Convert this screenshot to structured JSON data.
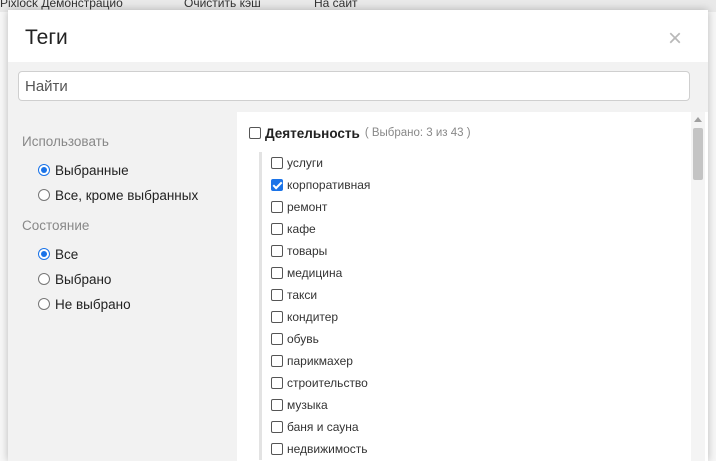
{
  "background": {
    "strip_texts": [
      "Pixlock Демонстрацио",
      "Очистить кэш",
      "На сайт"
    ]
  },
  "modal": {
    "title": "Теги",
    "close_icon": "×"
  },
  "search": {
    "placeholder": "Найти"
  },
  "filters": {
    "use_title": "Использовать",
    "use_options": [
      {
        "label": "Выбранные",
        "selected": true
      },
      {
        "label": "Все, кроме выбранных",
        "selected": false
      }
    ],
    "state_title": "Состояние",
    "state_options": [
      {
        "label": "Все",
        "selected": true
      },
      {
        "label": "Выбрано",
        "selected": false
      },
      {
        "label": "Не выбрано",
        "selected": false
      }
    ]
  },
  "group": {
    "name": "Деятельность",
    "count": "( Выбрано: 3 из 43 )",
    "checked": false,
    "tags": [
      {
        "label": "услуги",
        "checked": false
      },
      {
        "label": "корпоративная",
        "checked": true
      },
      {
        "label": "ремонт",
        "checked": false
      },
      {
        "label": "кафе",
        "checked": false
      },
      {
        "label": "товары",
        "checked": false
      },
      {
        "label": "медицина",
        "checked": false
      },
      {
        "label": "такси",
        "checked": false
      },
      {
        "label": "кондитер",
        "checked": false
      },
      {
        "label": "обувь",
        "checked": false
      },
      {
        "label": "парикмахер",
        "checked": false
      },
      {
        "label": "строительство",
        "checked": false
      },
      {
        "label": "музыка",
        "checked": false
      },
      {
        "label": "баня и сауна",
        "checked": false
      },
      {
        "label": "недвижимость",
        "checked": false
      }
    ]
  },
  "colors": {
    "accent": "#1a73e8",
    "panel_bg": "#f2f2f2",
    "muted_text": "#888888"
  }
}
